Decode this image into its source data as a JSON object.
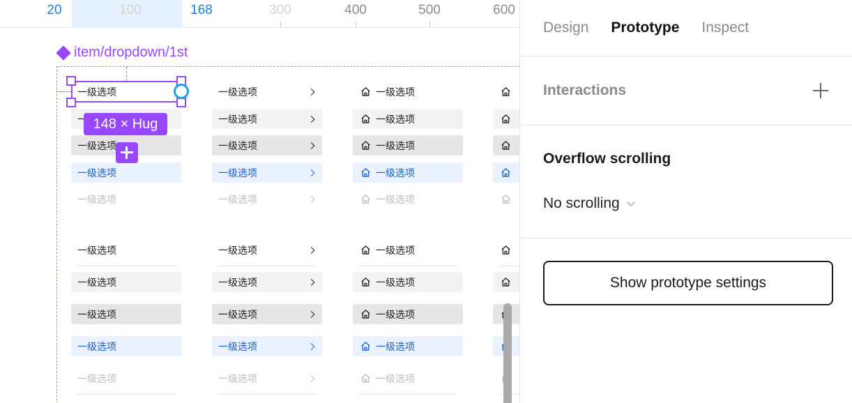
{
  "ruler": {
    "ticks": [
      "20",
      "100",
      "168",
      "300",
      "400",
      "500",
      "600"
    ]
  },
  "canvas": {
    "frame_label": "item/dropdown/1st",
    "item_label": "一级选项",
    "size_badge": "148 × Hug"
  },
  "panel": {
    "tabs": [
      "Design",
      "Prototype",
      "Inspect"
    ],
    "active_tab": "Prototype",
    "interactions_title": "Interactions",
    "overflow_title": "Overflow scrolling",
    "overflow_value": "No scrolling",
    "prototype_settings_button": "Show prototype settings"
  },
  "colors": {
    "selection": "#9747ff",
    "guide": "#18a0fb",
    "active_item_text": "#1a5fd0",
    "active_item_bg": "#e9f2fe"
  },
  "icons": [
    "component-icon",
    "chevron-right-icon",
    "home-icon",
    "plus-icon",
    "chevron-down-icon"
  ]
}
